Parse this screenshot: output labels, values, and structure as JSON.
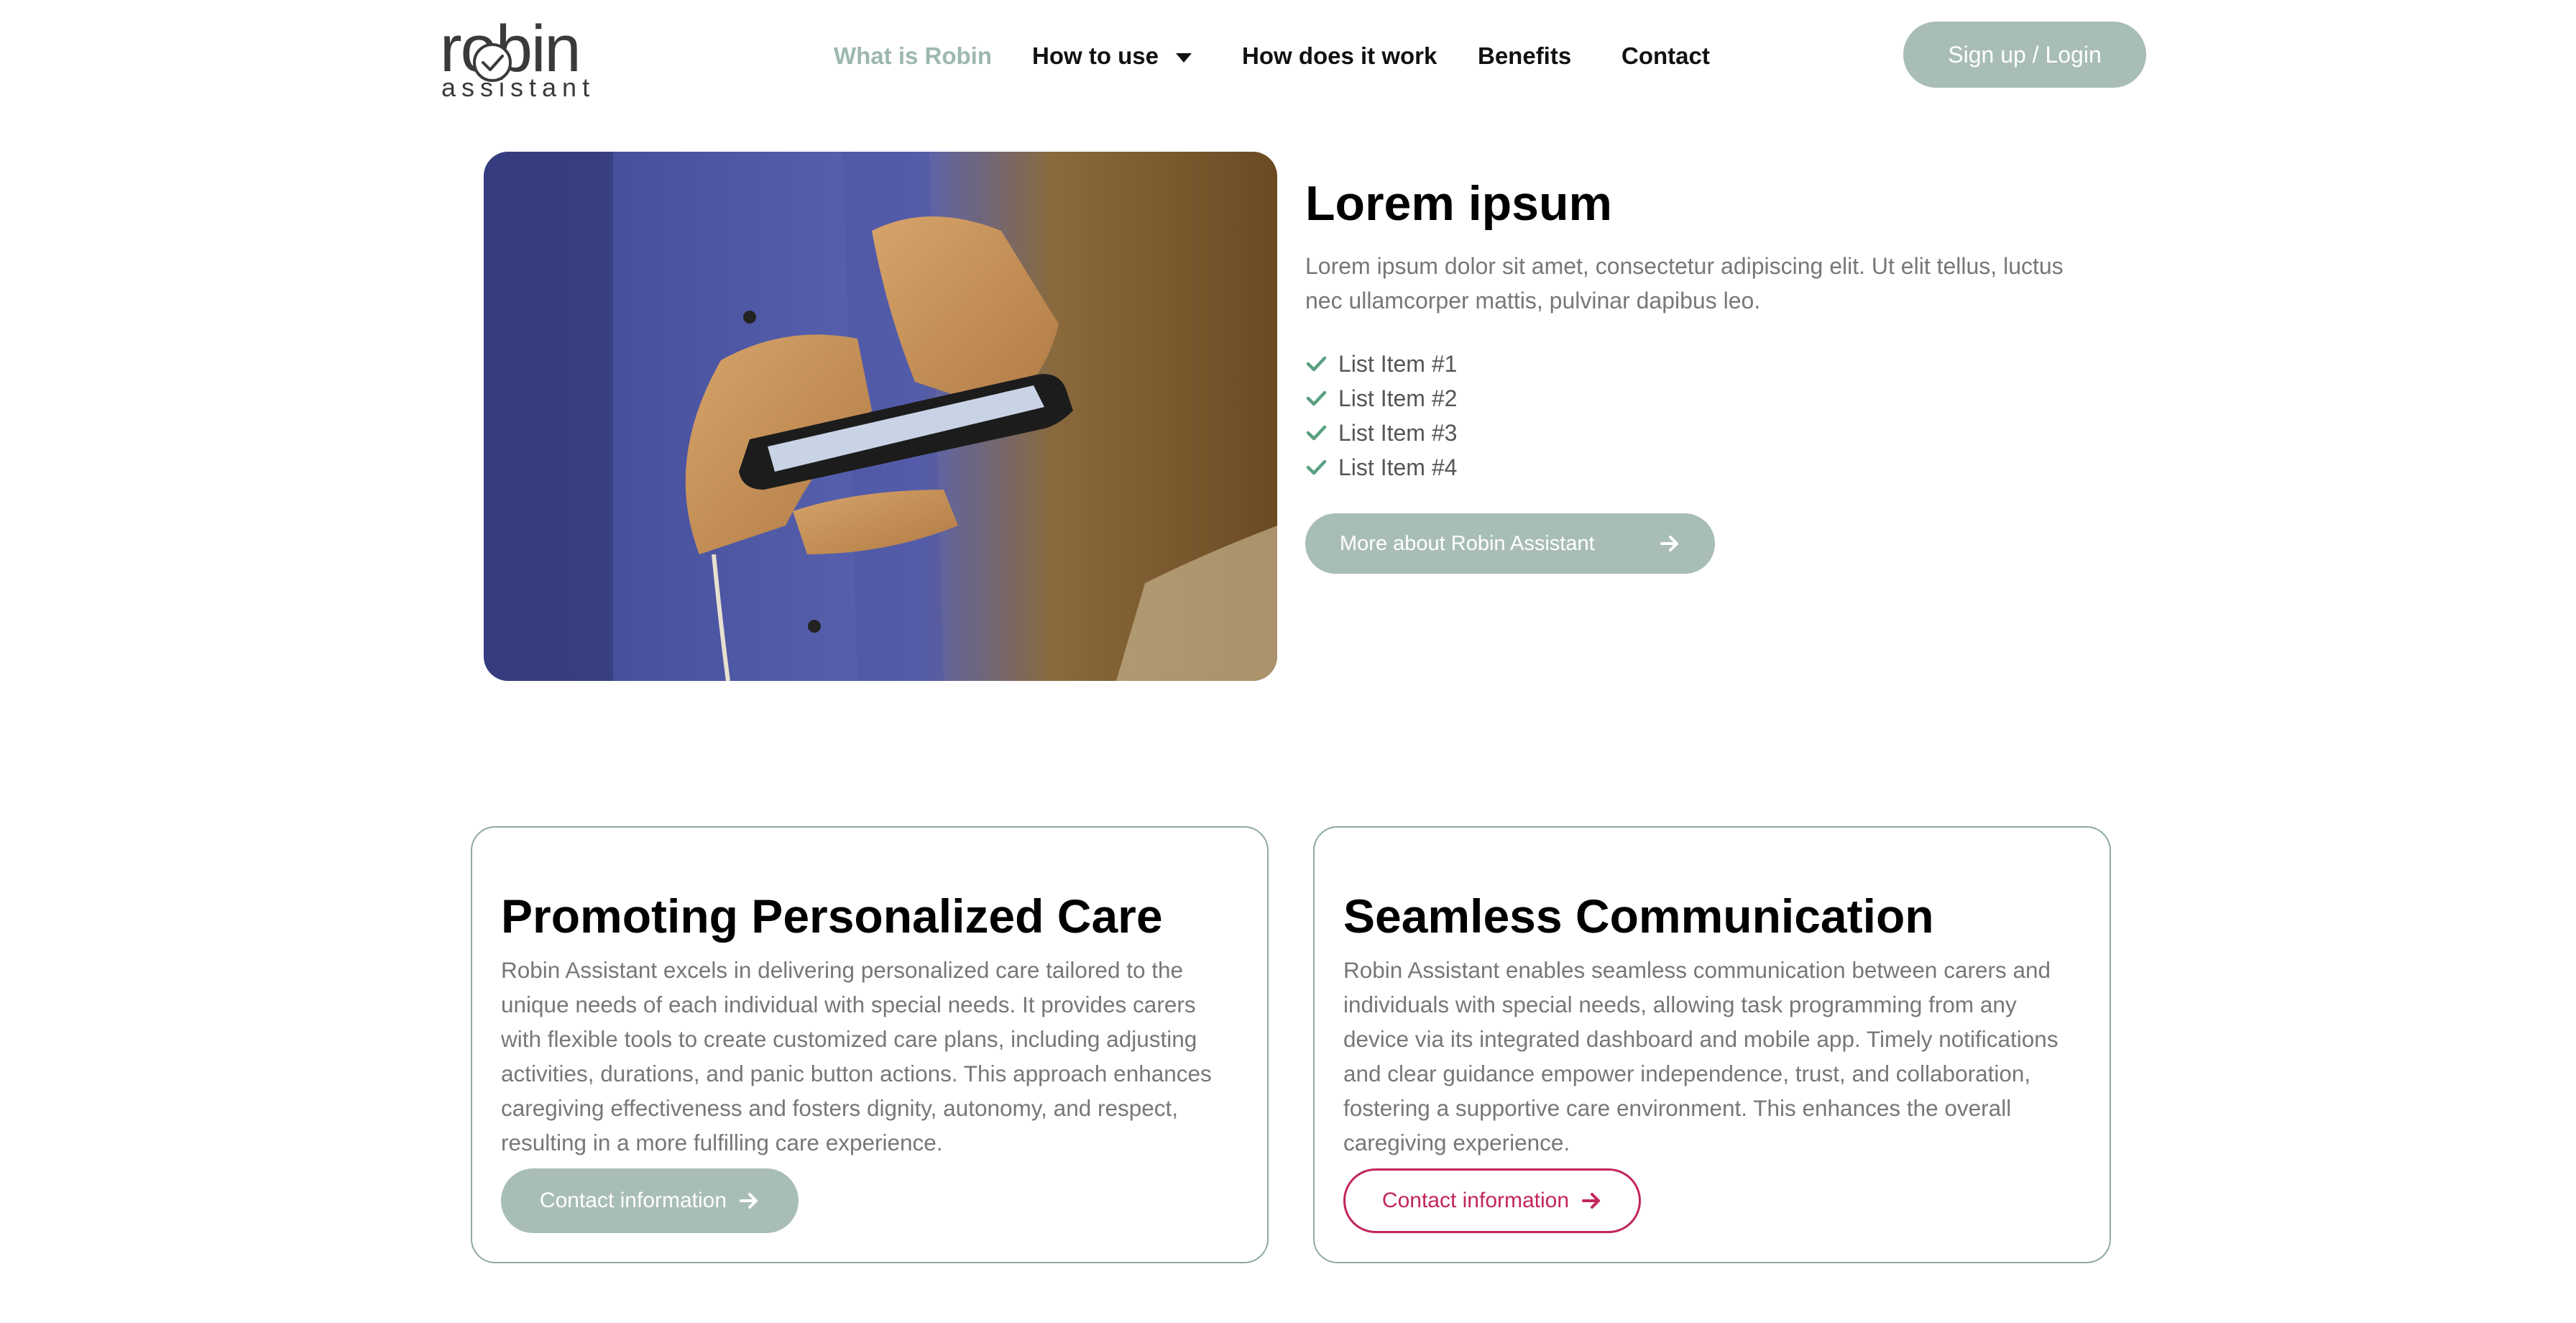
{
  "brand": {
    "logo_word": "robin",
    "logo_sub": "assistant",
    "text_color": "#3a3a3a"
  },
  "nav": {
    "items": [
      {
        "label": "What is Robin",
        "active": true
      },
      {
        "label": "How to use",
        "has_dropdown": true
      },
      {
        "label": "How does it work"
      },
      {
        "label": "Benefits"
      },
      {
        "label": "Contact"
      }
    ],
    "login_label": "Sign up / Login"
  },
  "hero": {
    "image_icon": "phone-in-hands-photo",
    "title": "Lorem ipsum",
    "description": "Lorem ipsum dolor sit amet, consectetur adipiscing elit. Ut elit tellus, luctus nec ullamcorper mattis, pulvinar dapibus leo.",
    "list": [
      "List Item #1",
      "List Item #2",
      "List Item #3",
      "List Item #4"
    ],
    "cta_label": "More about Robin Assistant"
  },
  "cards": [
    {
      "title": "Promoting Personalized Care",
      "text": "Robin Assistant excels in delivering personalized care tailored to the unique needs of each individual with special needs. It provides carers with flexible tools to create customized care plans, including adjusting activities, durations, and panic button actions. This approach enhances caregiving effectiveness and fosters dignity, autonomy, and respect, resulting in a more fulfilling care experience.",
      "button_label": "Contact information"
    },
    {
      "title": "Seamless Communication",
      "text": "Robin Assistant enables seamless communication between carers and individuals with special needs, allowing task programming from any device via its integrated dashboard and mobile app. Timely notifications and clear guidance empower independence, trust, and collaboration, fostering a supportive care environment. This enhances the overall caregiving experience.",
      "button_label": "Contact information"
    }
  ],
  "colors": {
    "accent_sage": "#a8bdb5",
    "active_nav": "#9db8ae",
    "check_green": "#5aa080",
    "outline_crimson": "#c2255c",
    "card_border": "#8faaa0"
  }
}
